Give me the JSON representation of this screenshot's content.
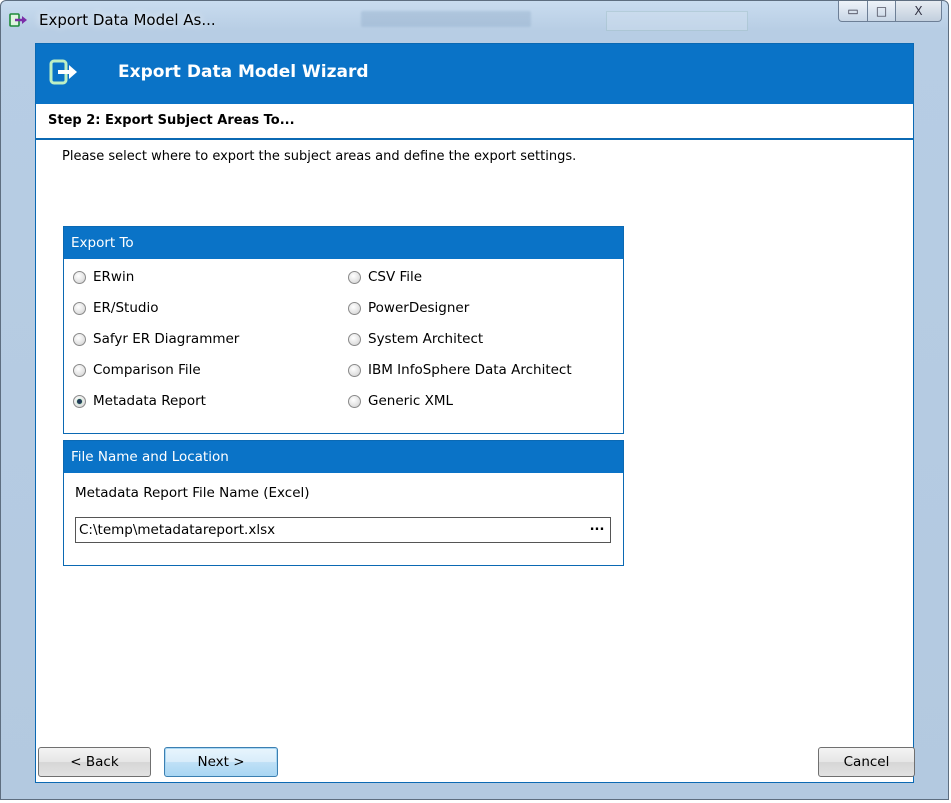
{
  "window": {
    "title": "Export Data Model As...",
    "controls": {
      "minimize": "▭",
      "maximize": "□",
      "close": "X"
    }
  },
  "wizard": {
    "title": "Export Data Model Wizard",
    "step": "Step 2: Export Subject Areas To...",
    "instruction": "Please select where to export the subject areas and define the export settings."
  },
  "export_to": {
    "heading": "Export To",
    "selected": "Metadata Report",
    "options_left": [
      "ERwin",
      "ER/Studio",
      "Safyr ER Diagrammer",
      "Comparison File",
      "Metadata Report"
    ],
    "options_right": [
      "CSV File",
      "PowerDesigner",
      "System Architect",
      "IBM InfoSphere Data Architect",
      "Generic XML"
    ]
  },
  "file": {
    "heading": "File Name and Location",
    "label": "Metadata Report File Name (Excel)",
    "value": "C:\\temp\\metadatareport.xlsx",
    "browse": "..."
  },
  "buttons": {
    "back": "< Back",
    "next": "Next >",
    "cancel": "Cancel"
  },
  "colors": {
    "accent": "#0a73c7",
    "border": "#0b69b3"
  }
}
